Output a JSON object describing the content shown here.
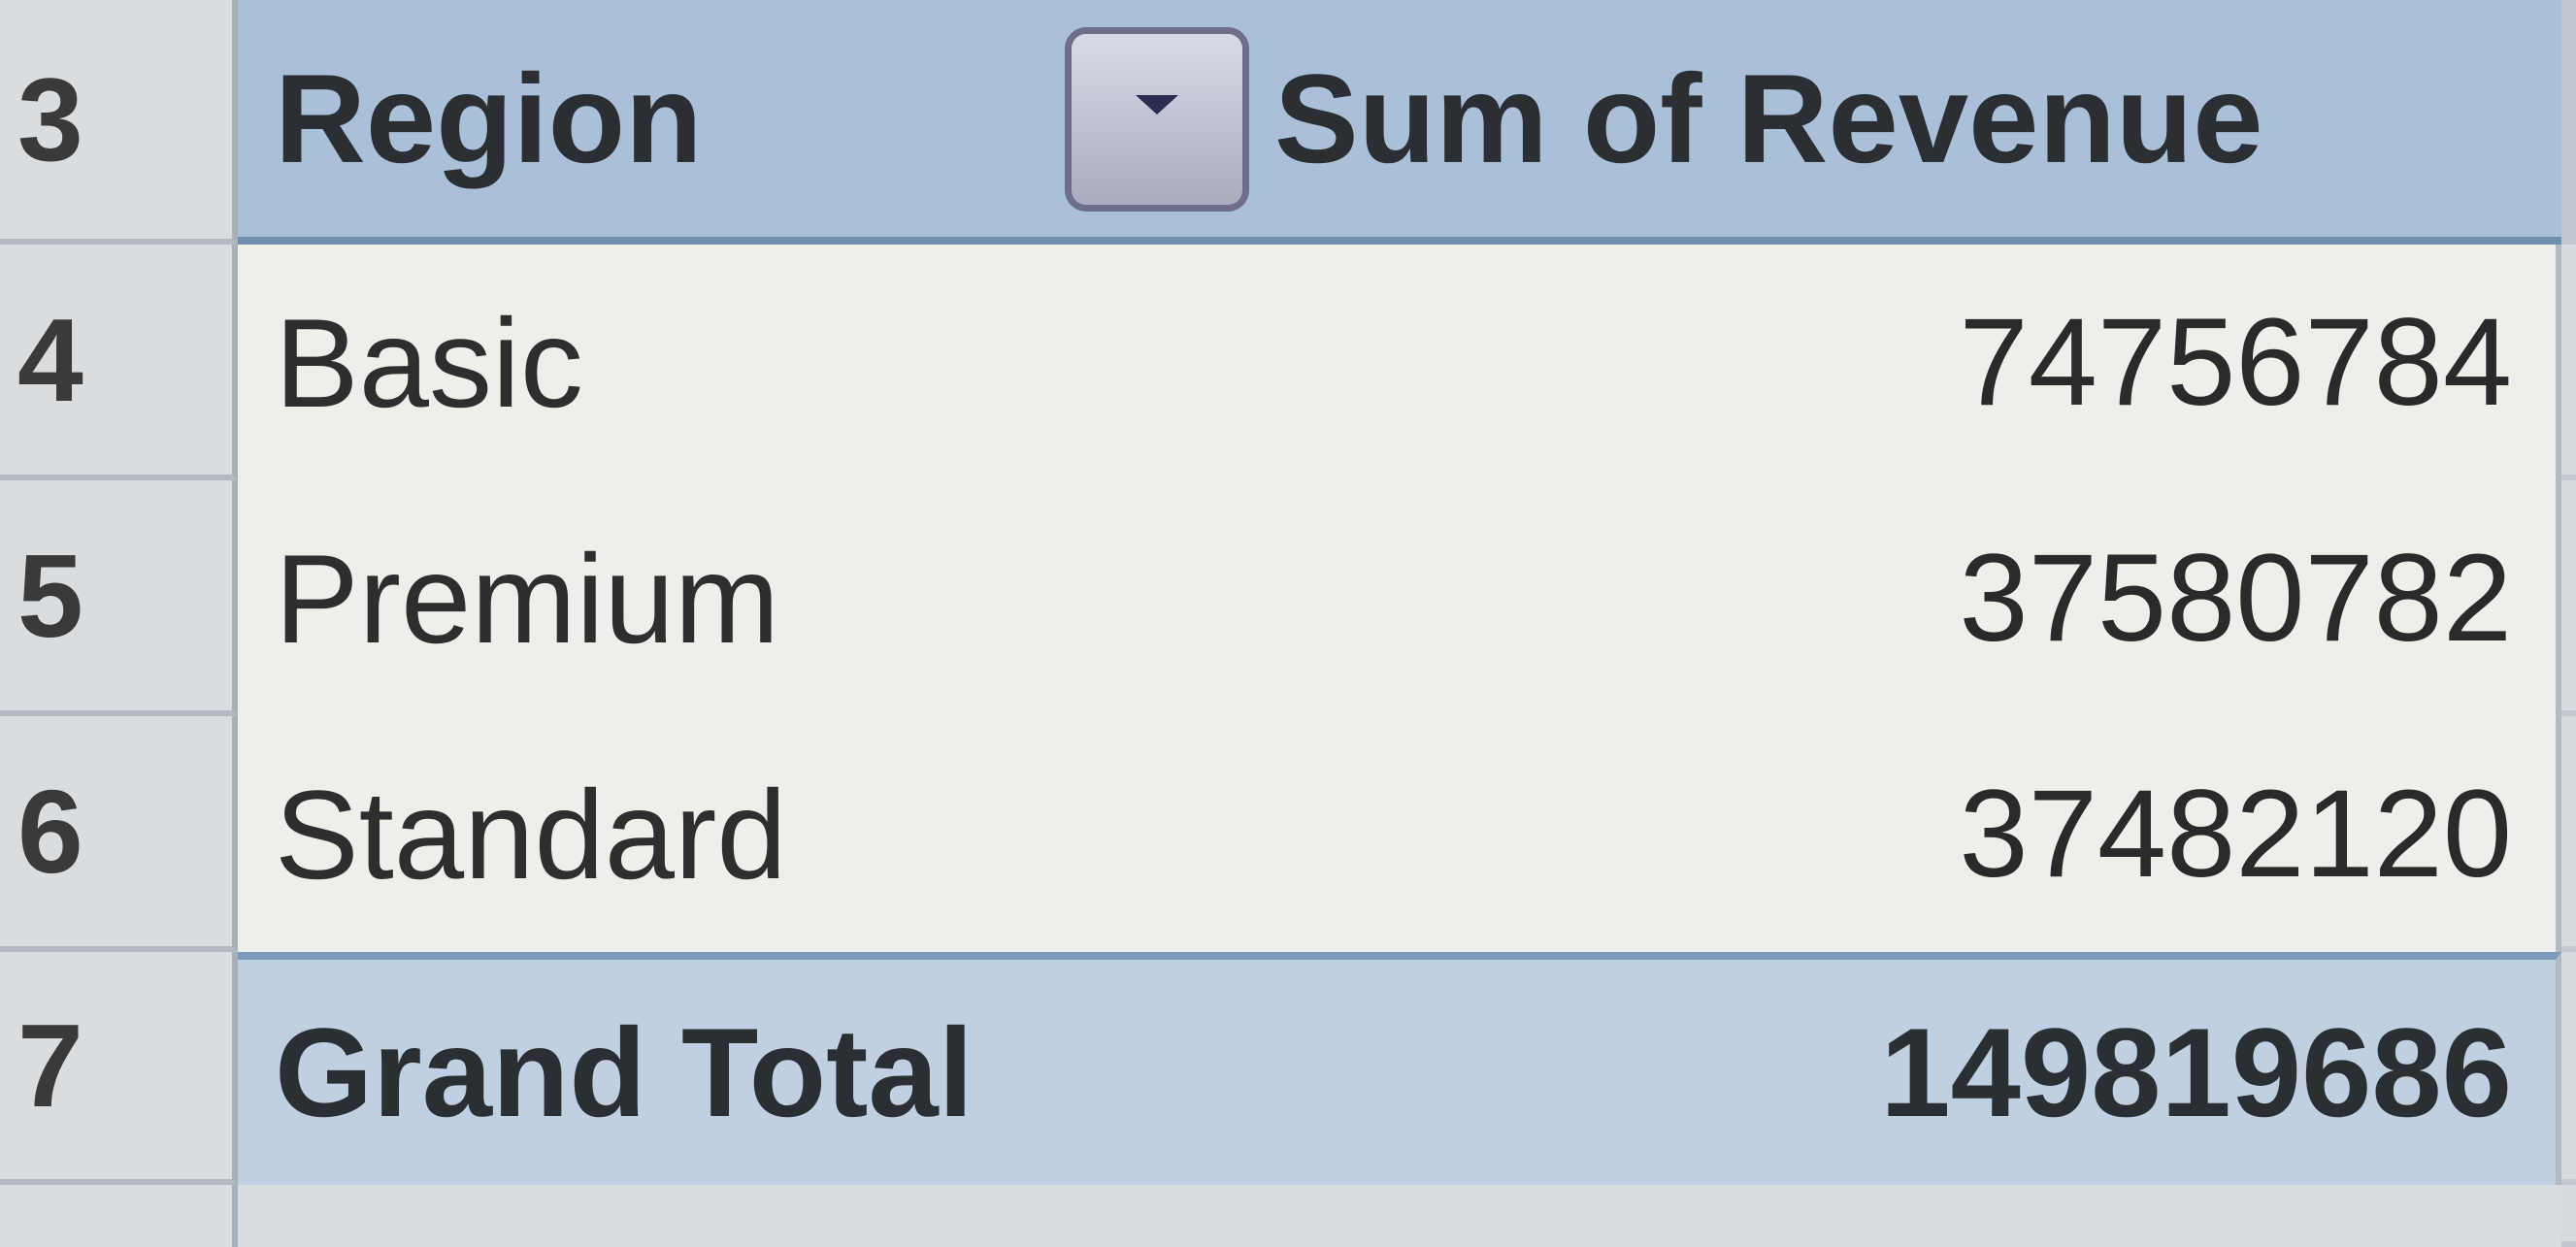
{
  "pivot": {
    "header": {
      "row_number": "3",
      "row_label": "Region",
      "value_label": "Sum of Revenue",
      "filter_icon": "dropdown-arrow-icon"
    },
    "rows": [
      {
        "row_number": "4",
        "label": "Basic",
        "value": "74756784"
      },
      {
        "row_number": "5",
        "label": "Premium",
        "value": "37580782"
      },
      {
        "row_number": "6",
        "label": "Standard",
        "value": "37482120"
      }
    ],
    "total": {
      "row_number": "7",
      "label": "Grand Total",
      "value": "149819686"
    }
  },
  "colors": {
    "header_fill": "#a9c0d8",
    "total_fill": "#bfd0e2",
    "data_fill": "#efefea",
    "row_header_fill": "#d9dde0"
  }
}
